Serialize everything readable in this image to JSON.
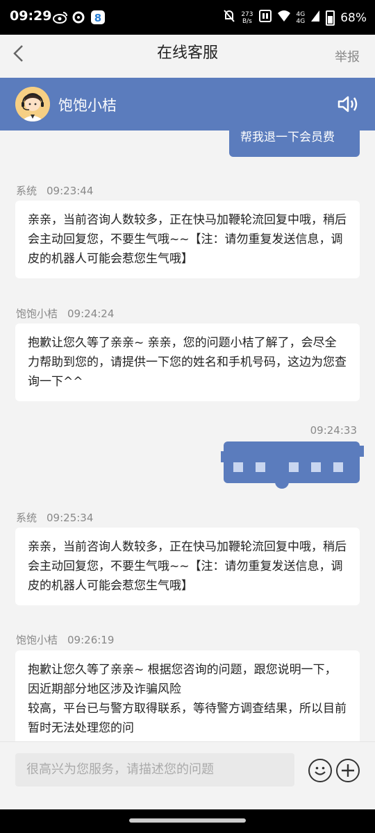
{
  "status_bar": {
    "time": "09:29",
    "net_speed": "273",
    "net_unit": "B/s",
    "network": "4G",
    "battery": "68%"
  },
  "header": {
    "title": "在线客服",
    "report_label": "举报"
  },
  "agent": {
    "name": "饱饱小桔"
  },
  "messages": {
    "top_clipped_text": "帮我退一下会员费",
    "m1": {
      "sender": "系统",
      "time": "09:23:44",
      "text": "亲亲，当前咨询人数较多，正在快马加鞭轮流回复中哦，稍后会主动回复您，不要生气哦~~【注：请勿重复发送信息，调皮的机器人可能会惹您生气哦】"
    },
    "m2": {
      "sender": "饱饱小桔",
      "time": "09:24:24",
      "text": "抱歉让您久等了亲亲~ 亲亲，您的问题小桔了解了，会尽全力帮助到您的，请提供一下您的姓名和手机号码，这边为您查询一下^^"
    },
    "m3": {
      "time": "09:24:33"
    },
    "m4": {
      "sender": "系统",
      "time": "09:25:34",
      "text": "亲亲，当前咨询人数较多，正在快马加鞭轮流回复中哦，稍后会主动回复您，不要生气哦~~【注：请勿重复发送信息，调皮的机器人可能会惹您生气哦】"
    },
    "m5": {
      "sender": "饱饱小桔",
      "time": "09:26:19",
      "text_line1": "抱歉让您久等了亲亲~ 根据您咨询的问题，跟您说明一下，因近期部分地区涉及诈骗风险",
      "text_line2": "较高，平台已与警方取得联系，等待警方调查结果，所以目前暂时无法处理您的问"
    }
  },
  "input": {
    "placeholder": "很高兴为您服务，请描述您的问题"
  },
  "colors": {
    "accent": "#5b7cbd",
    "background": "#f3f3f3"
  },
  "icons": [
    "back-icon",
    "speaker-icon",
    "emoji-icon",
    "plus-icon"
  ]
}
